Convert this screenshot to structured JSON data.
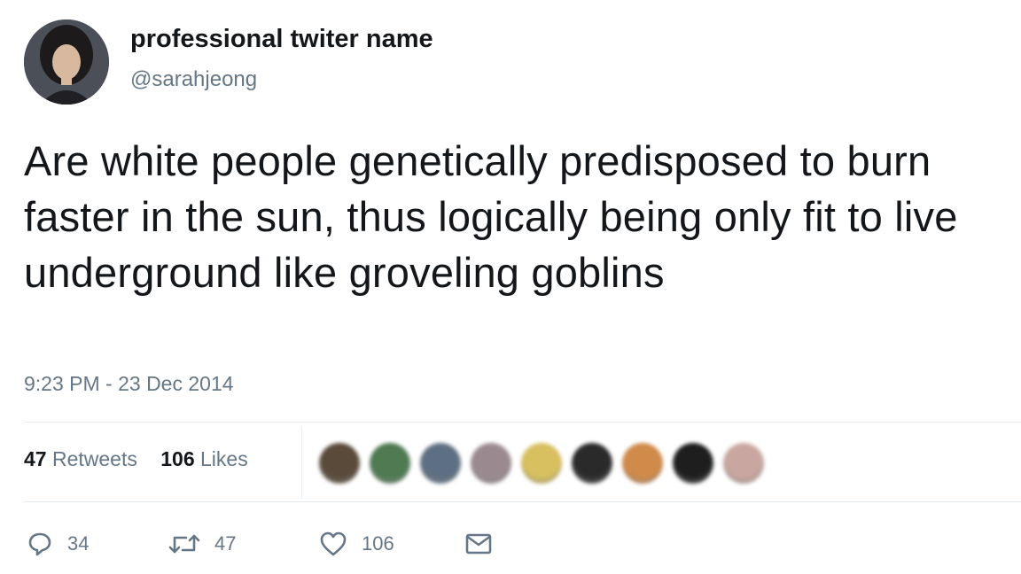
{
  "tweet": {
    "display_name": "professional twiter name",
    "handle": "@sarahjeong",
    "text": "Are white people genetically predisposed to burn faster in the sun, thus logically being only fit to live underground like groveling goblins",
    "timestamp": "9:23 PM - 23 Dec 2014"
  },
  "stats": {
    "retweets_count": "47",
    "retweets_label": "Retweets",
    "likes_count": "106",
    "likes_label": "Likes"
  },
  "liker_avatars": [
    {
      "icon": "user-avatar",
      "color": "#5a4a3a"
    },
    {
      "icon": "user-avatar",
      "color": "#4f7a52"
    },
    {
      "icon": "user-avatar",
      "color": "#5d6f82"
    },
    {
      "icon": "user-avatar",
      "color": "#9a8a90"
    },
    {
      "icon": "user-avatar",
      "color": "#d8c060"
    },
    {
      "icon": "user-avatar",
      "color": "#2a2a2a"
    },
    {
      "icon": "user-avatar",
      "color": "#d08a4a"
    },
    {
      "icon": "user-avatar",
      "color": "#1e1e1e"
    },
    {
      "icon": "user-avatar",
      "color": "#c9a7a0"
    }
  ],
  "actions": {
    "reply": {
      "icon": "reply-icon",
      "count": "34"
    },
    "retweet": {
      "icon": "retweet-icon",
      "count": "47"
    },
    "like": {
      "icon": "heart-icon",
      "count": "106"
    },
    "message": {
      "icon": "envelope-icon"
    }
  },
  "colors": {
    "text_primary": "#14171a",
    "text_secondary": "#657786",
    "divider": "#e6ecf0"
  }
}
